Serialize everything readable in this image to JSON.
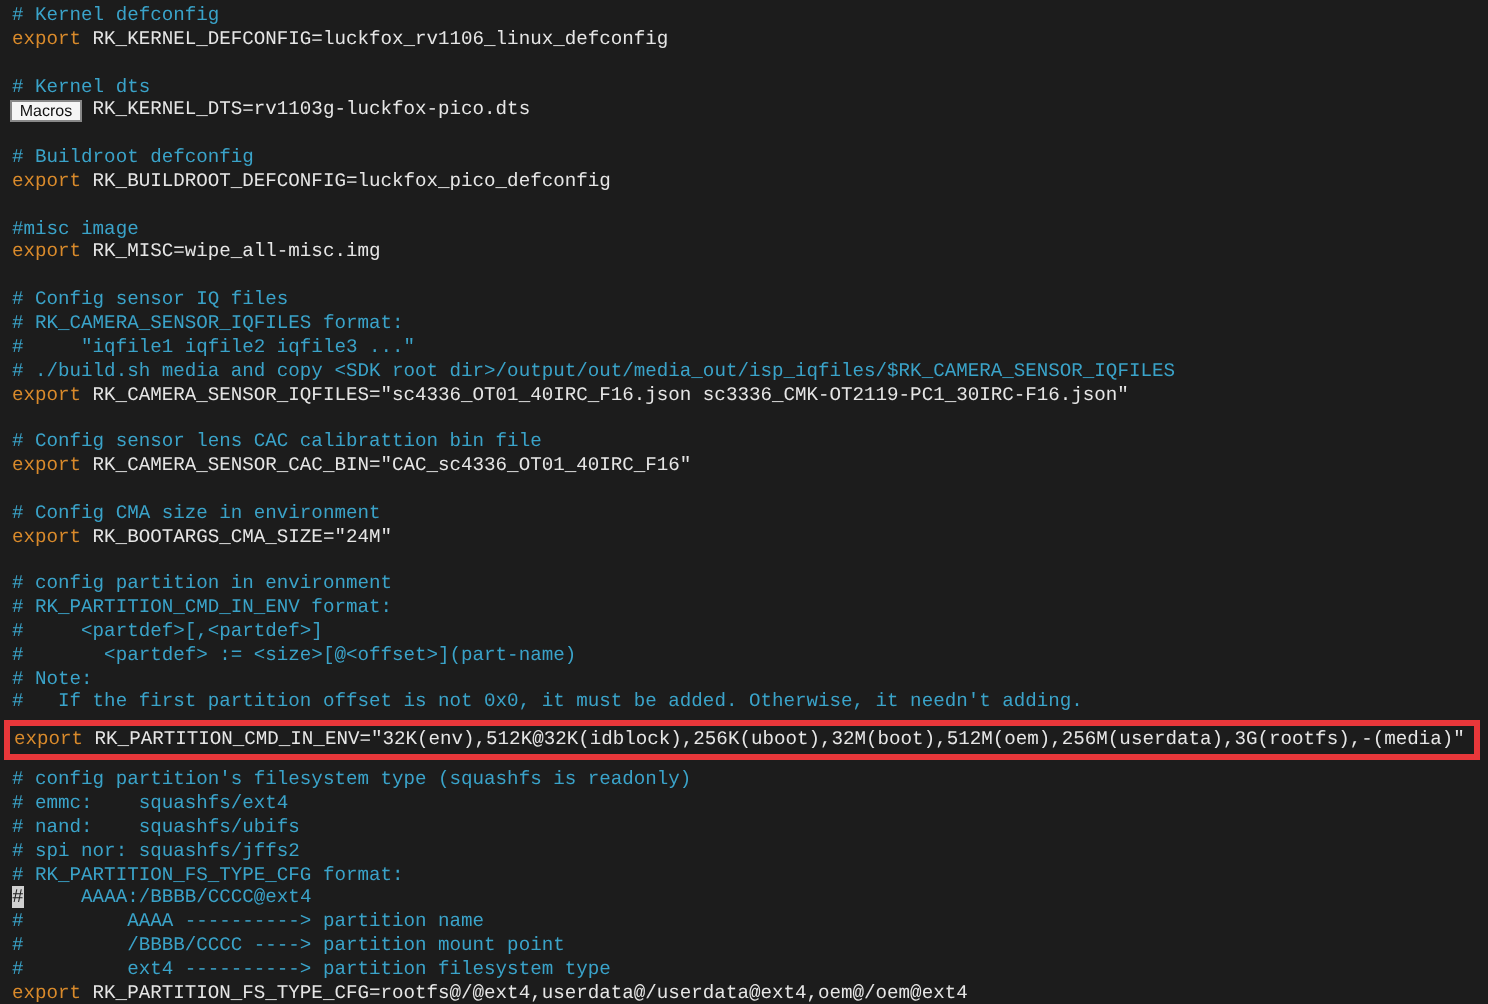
{
  "editor": {
    "lines": [
      {
        "kind": "comment",
        "text": "# Kernel defconfig",
        "cursor": false
      },
      {
        "kind": "export",
        "keyword": "export",
        "text": "RK_KERNEL_DEFCONFIG=luckfox_rv1106_linux_defconfig",
        "cursor": false
      },
      {
        "kind": "blank"
      },
      {
        "kind": "comment",
        "text": "# Kernel dts",
        "cursor": false
      },
      {
        "kind": "export",
        "text": "RK_KERNEL_DTS=rv1103g-luckfox-pico.dts",
        "cursor": false
      },
      {
        "kind": "blank"
      },
      {
        "kind": "comment",
        "text": "# Buildroot defconfig",
        "cursor": false
      },
      {
        "kind": "export",
        "keyword": "export",
        "text": "RK_BUILDROOT_DEFCONFIG=luckfox_pico_defconfig",
        "cursor": false
      },
      {
        "kind": "blank"
      },
      {
        "kind": "comment",
        "text": "#misc image",
        "cursor": false
      },
      {
        "kind": "export",
        "keyword": "export",
        "text": "RK_MISC=wipe_all-misc.img",
        "cursor": false
      },
      {
        "kind": "blank"
      },
      {
        "kind": "comment",
        "text": "# Config sensor IQ files",
        "cursor": false
      },
      {
        "kind": "comment",
        "text": "# RK_CAMERA_SENSOR_IQFILES format:",
        "cursor": false
      },
      {
        "kind": "comment",
        "text": "#     \"iqfile1 iqfile2 iqfile3 ...\"",
        "cursor": false
      },
      {
        "kind": "comment",
        "text": "# ./build.sh media and copy <SDK root dir>/output/out/media_out/isp_iqfiles/$RK_CAMERA_SENSOR_IQFILES",
        "cursor": false
      },
      {
        "kind": "export",
        "keyword": "export",
        "text": "RK_CAMERA_SENSOR_IQFILES=\"sc4336_OT01_40IRC_F16.json sc3336_CMK-OT2119-PC1_30IRC-F16.json\"",
        "cursor": false
      },
      {
        "kind": "blank"
      },
      {
        "kind": "comment",
        "text": "# Config sensor lens CAC calibrattion bin file",
        "cursor": false
      },
      {
        "kind": "export",
        "keyword": "export",
        "text": "RK_CAMERA_SENSOR_CAC_BIN=\"CAC_sc4336_OT01_40IRC_F16\"",
        "cursor": false
      },
      {
        "kind": "blank"
      },
      {
        "kind": "comment",
        "text": "# Config CMA size in environment",
        "cursor": false
      },
      {
        "kind": "export",
        "keyword": "export",
        "text": "RK_BOOTARGS_CMA_SIZE=\"24M\"",
        "cursor": false
      },
      {
        "kind": "blank"
      },
      {
        "kind": "comment",
        "text": "# config partition in environment",
        "cursor": false
      },
      {
        "kind": "comment",
        "text": "# RK_PARTITION_CMD_IN_ENV format:",
        "cursor": false
      },
      {
        "kind": "comment",
        "text": "#     <partdef>[,<partdef>]",
        "cursor": false
      },
      {
        "kind": "comment",
        "text": "#       <partdef> := <size>[@<offset>](part-name)",
        "cursor": false
      },
      {
        "kind": "comment",
        "text": "# Note:",
        "cursor": false
      },
      {
        "kind": "comment",
        "text": "#   If the first partition offset is not 0x0, it must be added. Otherwise, it needn't adding.",
        "cursor": false
      },
      {
        "kind": "export",
        "keyword": "export",
        "text": "RK_PARTITION_CMD_IN_ENV=\"32K(env),512K@32K(idblock),256K(uboot),32M(boot),512M(oem),256M(userdata),3G(rootfs),-(media)\"",
        "cursor": false,
        "highlighted": true
      },
      {
        "kind": "comment",
        "text": "# config partition's filesystem type (squashfs is readonly)",
        "cursor": false
      },
      {
        "kind": "comment",
        "text": "# emmc:    squashfs/ext4",
        "cursor": false
      },
      {
        "kind": "comment",
        "text": "# nand:    squashfs/ubifs",
        "cursor": false
      },
      {
        "kind": "comment",
        "text": "# spi nor: squashfs/jffs2",
        "cursor": false
      },
      {
        "kind": "comment",
        "text": "# RK_PARTITION_FS_TYPE_CFG format:",
        "cursor": false
      },
      {
        "kind": "comment",
        "text": "#     AAAA:/BBBB/CCCC@ext4",
        "cursor": true
      },
      {
        "kind": "comment",
        "text": "#         AAAA ----------> partition name",
        "cursor": false
      },
      {
        "kind": "comment",
        "text": "#         /BBBB/CCCC ----> partition mount point",
        "cursor": false
      },
      {
        "kind": "comment",
        "text": "#         ext4 ----------> partition filesystem type",
        "cursor": false
      },
      {
        "kind": "export",
        "keyword": "export",
        "text": "RK_PARTITION_FS_TYPE_CFG=rootfs@/@ext4,userdata@/userdata@ext4,oem@/oem@ext4",
        "cursor": false
      }
    ]
  },
  "tooltip": {
    "text": "Macros"
  }
}
